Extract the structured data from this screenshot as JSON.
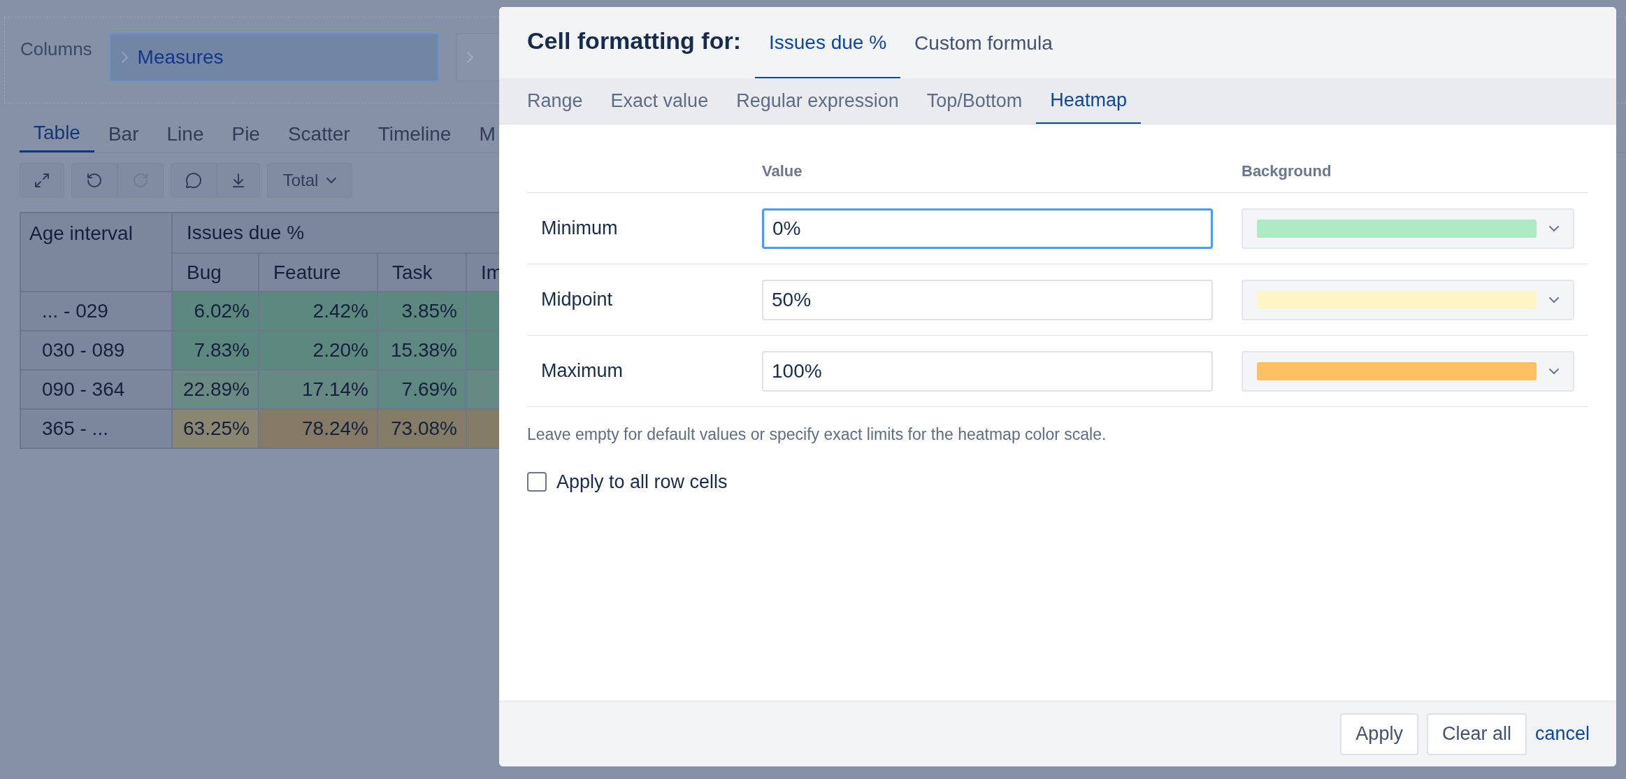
{
  "background": {
    "columns_label": "Columns",
    "chip": "Measures",
    "view_tabs": [
      {
        "label": "Table",
        "selected": true
      },
      {
        "label": "Bar",
        "selected": false
      },
      {
        "label": "Line",
        "selected": false
      },
      {
        "label": "Pie",
        "selected": false
      },
      {
        "label": "Scatter",
        "selected": false
      },
      {
        "label": "Timeline",
        "selected": false
      },
      {
        "label": "M",
        "selected": false
      }
    ],
    "total_dropdown": "Total",
    "table": {
      "corner": "Age interval",
      "group": "Issues due %",
      "columns": [
        "Bug",
        "Feature",
        "Task",
        "Im"
      ],
      "rows": [
        {
          "label": "... - 029",
          "cells": [
            {
              "value": "6.02%",
              "color": "#5c8880"
            },
            {
              "value": "2.42%",
              "color": "#5c8880"
            },
            {
              "value": "3.85%",
              "color": "#5c8880"
            },
            {
              "color": "#5c8880"
            }
          ]
        },
        {
          "label": "030 - 089",
          "cells": [
            {
              "value": "7.83%",
              "color": "#5c8880"
            },
            {
              "value": "2.20%",
              "color": "#5c8880"
            },
            {
              "value": "15.38%",
              "color": "#5f8882"
            },
            {
              "color": "#5c8880"
            }
          ]
        },
        {
          "label": "090 - 364",
          "cells": [
            {
              "value": "22.89%",
              "color": "#6c8a84"
            },
            {
              "value": "17.14%",
              "color": "#668983"
            },
            {
              "value": "7.69%",
              "color": "#5f8882"
            },
            {
              "color": "#668983"
            }
          ]
        },
        {
          "label": "365 - ...",
          "cells": [
            {
              "value": "63.25%",
              "color": "#8a8672"
            },
            {
              "value": "78.24%",
              "color": "#857a65"
            },
            {
              "value": "73.08%",
              "color": "#857c67"
            },
            {
              "color": "#857c67"
            }
          ]
        }
      ]
    }
  },
  "dialog": {
    "title": "Cell formatting for:",
    "target_tabs": [
      {
        "label": "Issues due %",
        "selected": true
      },
      {
        "label": "Custom formula",
        "selected": false
      }
    ],
    "rule_tabs": [
      {
        "label": "Range",
        "selected": false
      },
      {
        "label": "Exact value",
        "selected": false
      },
      {
        "label": "Regular expression",
        "selected": false
      },
      {
        "label": "Top/Bottom",
        "selected": false
      },
      {
        "label": "Heatmap",
        "selected": true
      }
    ],
    "columns": [
      "Value",
      "Background"
    ],
    "rows": [
      {
        "label": "Minimum",
        "value": "0%",
        "focused": true,
        "color": "#aeeac4"
      },
      {
        "label": "Midpoint",
        "value": "50%",
        "focused": false,
        "color": "#fef5c6"
      },
      {
        "label": "Maximum",
        "value": "100%",
        "focused": false,
        "color": "#ffc061"
      }
    ],
    "hint": "Leave empty for default values or specify exact limits for the heatmap color scale.",
    "apply_all": {
      "label": "Apply to all row cells",
      "checked": false
    },
    "buttons": [
      {
        "label": "Apply",
        "kind": "button"
      },
      {
        "label": "Clear all",
        "kind": "button"
      },
      {
        "label": "cancel",
        "kind": "link"
      }
    ]
  }
}
